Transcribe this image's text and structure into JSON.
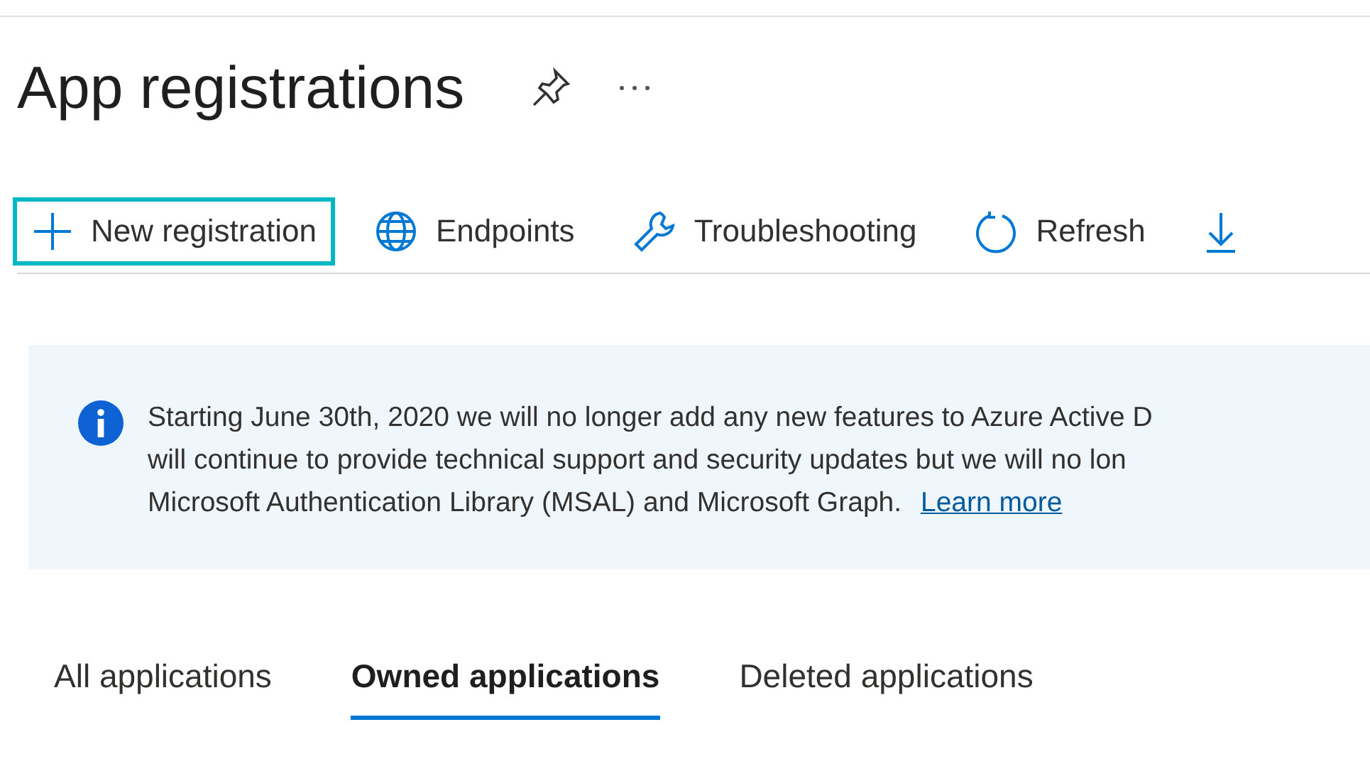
{
  "page": {
    "title": "App registrations"
  },
  "toolbar": [
    {
      "kind": "add",
      "label": "New registration",
      "focused": true
    },
    {
      "kind": "globe",
      "label": "Endpoints",
      "focused": false
    },
    {
      "kind": "wrench",
      "label": "Troubleshooting",
      "focused": false
    },
    {
      "kind": "refresh",
      "label": "Refresh",
      "focused": false
    },
    {
      "kind": "download",
      "focused": false
    }
  ],
  "banner": {
    "lines": [
      "Starting June 30th, 2020 we will no longer add any new features to Azure Active D",
      "will continue to provide technical support and security updates but we will no lon",
      "Microsoft Authentication Library (MSAL) and Microsoft Graph."
    ],
    "link": "Learn more"
  },
  "tabs": [
    {
      "label": "All applications",
      "selected": false
    },
    {
      "label": "Owned applications",
      "selected": true
    },
    {
      "label": "Deleted applications",
      "selected": false
    }
  ]
}
